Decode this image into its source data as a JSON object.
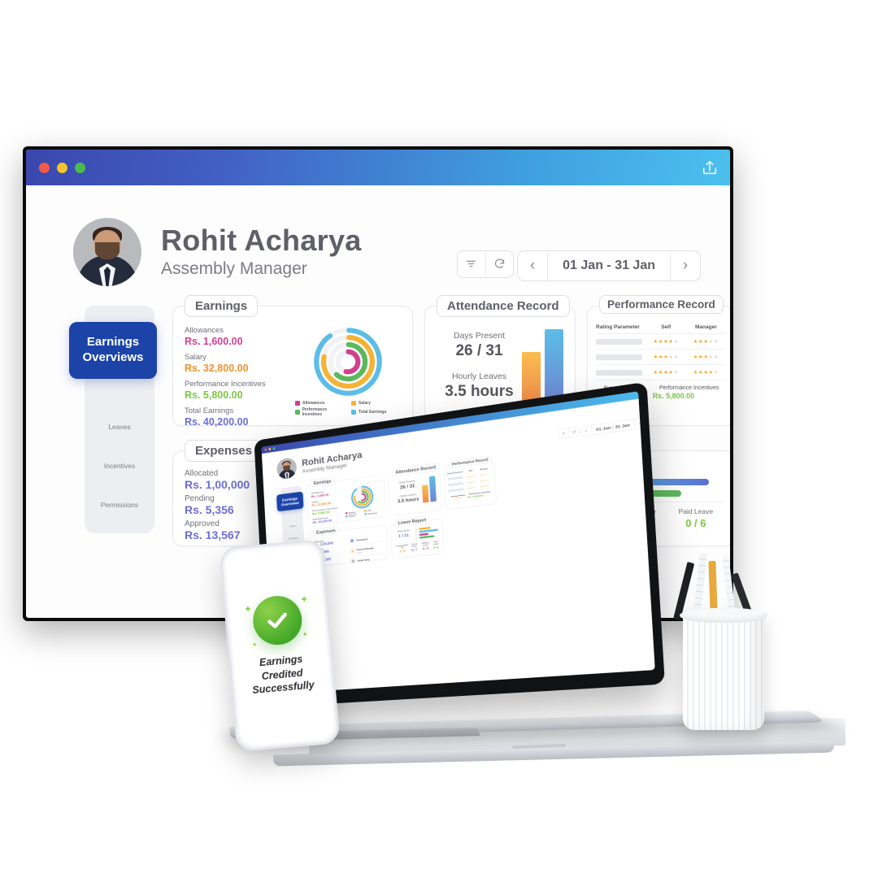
{
  "window": {
    "traffic_lights": [
      "close",
      "minimize",
      "maximize"
    ],
    "share_icon": "share-upload-icon"
  },
  "profile": {
    "name": "Rohit Acharya",
    "role": "Assembly Manager",
    "avatar": "user-avatar"
  },
  "header_actions": {
    "filter_icon": "filter-icon",
    "refresh_icon": "refresh-icon",
    "prev_icon": "chevron-left-icon",
    "next_icon": "chevron-right-icon",
    "date_range": "01 Jan - 31 Jan"
  },
  "sidebar": {
    "active": "Earnings Overviews",
    "items": [
      {
        "label": "Earnings Overviews",
        "active": true
      },
      {
        "label": "Leaves",
        "active": false
      },
      {
        "label": "Incentives",
        "active": false
      },
      {
        "label": "Permissions",
        "active": false
      }
    ]
  },
  "earnings": {
    "title": "Earnings",
    "rows": [
      {
        "label": "Allowances",
        "value": "Rs. 1,600.00",
        "color": "#d43f8d"
      },
      {
        "label": "Salary",
        "value": "Rs. 32,800.00",
        "color": "#f0932b"
      },
      {
        "label": "Performance Incentives",
        "value": "Rs. 5,800.00",
        "color": "#7ac943"
      },
      {
        "label": "Total Earnings",
        "value": "Rs. 40,200.00",
        "color": "#6b6fd4"
      }
    ],
    "legend": [
      {
        "label": "Allowances",
        "color": "#d43f8d"
      },
      {
        "label": "Salary",
        "color": "#f5b335"
      },
      {
        "label": "Performance Incentives",
        "color": "#5cb85c"
      },
      {
        "label": "Total Earnings",
        "color": "#5bbde8"
      }
    ]
  },
  "expenses": {
    "title": "Expenses",
    "rows": [
      {
        "label": "Allocated",
        "value": "Rs. 1,00,000"
      },
      {
        "label": "Pending",
        "value": "Rs. 5,356"
      },
      {
        "label": "Approved",
        "value": "Rs. 13,567"
      }
    ],
    "items": [
      {
        "name": "Transport",
        "sub": "",
        "icon": "bus-icon",
        "color": "#3a5fd9"
      },
      {
        "name": "Food & Drinks",
        "sub": "Lunch",
        "icon": "food-icon",
        "color": "#f0a732"
      },
      {
        "name": "Hotel Stay",
        "sub": "",
        "icon": "hotel-icon",
        "color": "#8c9aa8"
      }
    ]
  },
  "attendance": {
    "title": "Attendance Record",
    "days_present_label": "Days Present",
    "days_present_value": "26 / 31",
    "hourly_leaves_label": "Hourly Leaves",
    "hourly_leaves_value": "3.5 hours"
  },
  "performance": {
    "title": "Performance Record",
    "columns": [
      "Rating Parameter",
      "Self",
      "Manager"
    ],
    "rows": [
      {
        "parameter": "",
        "self": 4,
        "manager": 3
      },
      {
        "parameter": "",
        "self": 3,
        "manager": 3
      },
      {
        "parameter": "",
        "self": 4,
        "manager": 4
      }
    ],
    "average_label": "Average Ratings",
    "average_stars": 4,
    "incentive_label": "Performance Incentives",
    "incentive_value": "Rs. 5,800.00"
  },
  "leave_report": {
    "title": "Leave Report",
    "total_label": "Total Leaves",
    "total_value": "1 / 21",
    "bars": [
      {
        "code": "CO",
        "color": "#f5b335",
        "pct": 48
      },
      {
        "code": "CL",
        "color": "#5bbde8",
        "pct": 78
      },
      {
        "code": "VL",
        "color": "#d43f8d",
        "pct": 38
      },
      {
        "code": "PL",
        "color": "#5cb85c",
        "pct": 62
      }
    ],
    "footer": [
      {
        "label": "Compensation Off",
        "value": "1 / 5",
        "color": "#f0932b"
      },
      {
        "label": "Casual Leave",
        "value": "0 / 7",
        "color": "#5b6fd4"
      },
      {
        "label": "Vacation Leave",
        "value": "0 / 3",
        "color": "#d43f8d"
      },
      {
        "label": "Paid Leave",
        "value": "0 / 6",
        "color": "#7ac943"
      }
    ]
  },
  "phone": {
    "icon": "success-check-icon",
    "message": "Earnings\nCredited\nSuccessfully",
    "message_line1": "Earnings",
    "message_line2": "Credited",
    "message_line3": "Successfully"
  },
  "chart_data": {
    "type": "pie",
    "title": "Earnings",
    "labels": [
      "Allowances",
      "Salary",
      "Performance Incentives",
      "Total Earnings"
    ],
    "values": [
      1600,
      32800,
      5800,
      40200
    ],
    "colors": [
      "#d43f8d",
      "#f5b335",
      "#5cb85c",
      "#5bbde8"
    ],
    "legend_position": "bottom"
  }
}
